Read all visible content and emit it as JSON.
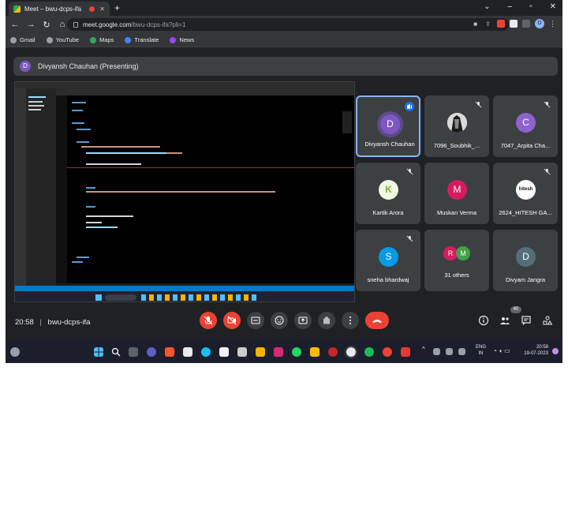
{
  "browser": {
    "tab_title": "Meet – bwu-dcps-ifa",
    "new_tab": "+",
    "url_host": "meet.google.com",
    "url_path": "/bwu-dcps-ifa?pli=1",
    "profile_initial": "D",
    "bookmarks": [
      {
        "label": "Gmail",
        "color": "#ea4335"
      },
      {
        "label": "YouTube",
        "color": "#ff0000"
      },
      {
        "label": "Maps",
        "color": "#34a853"
      },
      {
        "label": "Translate",
        "color": "#4285f4"
      },
      {
        "label": "News",
        "color": "#8ab4f8"
      }
    ]
  },
  "meet": {
    "presenter_initial": "D",
    "presenter_label": "Divyansh Chauhan (Presenting)",
    "participants": [
      {
        "name": "Divyansh Chauhan",
        "initial": "D",
        "color": "#7e57c2",
        "speaking": true
      },
      {
        "name": "7096_Soubhik_...",
        "initial": "",
        "color": "#ffffff",
        "photo": true
      },
      {
        "name": "7047_Arpita Cha...",
        "initial": "C",
        "color": "#8e63ce"
      },
      {
        "name": "Kartik Arora",
        "initial": "K",
        "color": "#e8f5c8",
        "photo": true
      },
      {
        "name": "Muskan Verma",
        "initial": "M",
        "color": "#d81b60"
      },
      {
        "name": "2624_HITESH GA...",
        "initial": "hitesh",
        "color": "#ffffff",
        "photo": true
      },
      {
        "name": "sneha bhardwaj",
        "initial": "S",
        "color": "#039be5"
      },
      {
        "name": "31 others",
        "initial": "R",
        "initial2": "M",
        "color": "#d81b60",
        "color2": "#43a047"
      },
      {
        "name": "Divyam Jangra",
        "initial": "D",
        "color": "#546e7a"
      }
    ],
    "time": "20:58",
    "meeting_code": "bwu-dcps-ifa",
    "people_count": "40"
  },
  "taskbar": {
    "lang": "ENG",
    "region": "IN",
    "clock_time": "20:58",
    "clock_date": "19-07-2023"
  },
  "colors": {
    "meet_bg": "#202124",
    "tile_bg": "#3c4043",
    "accent": "#8ab4f8",
    "danger": "#ea4335"
  }
}
